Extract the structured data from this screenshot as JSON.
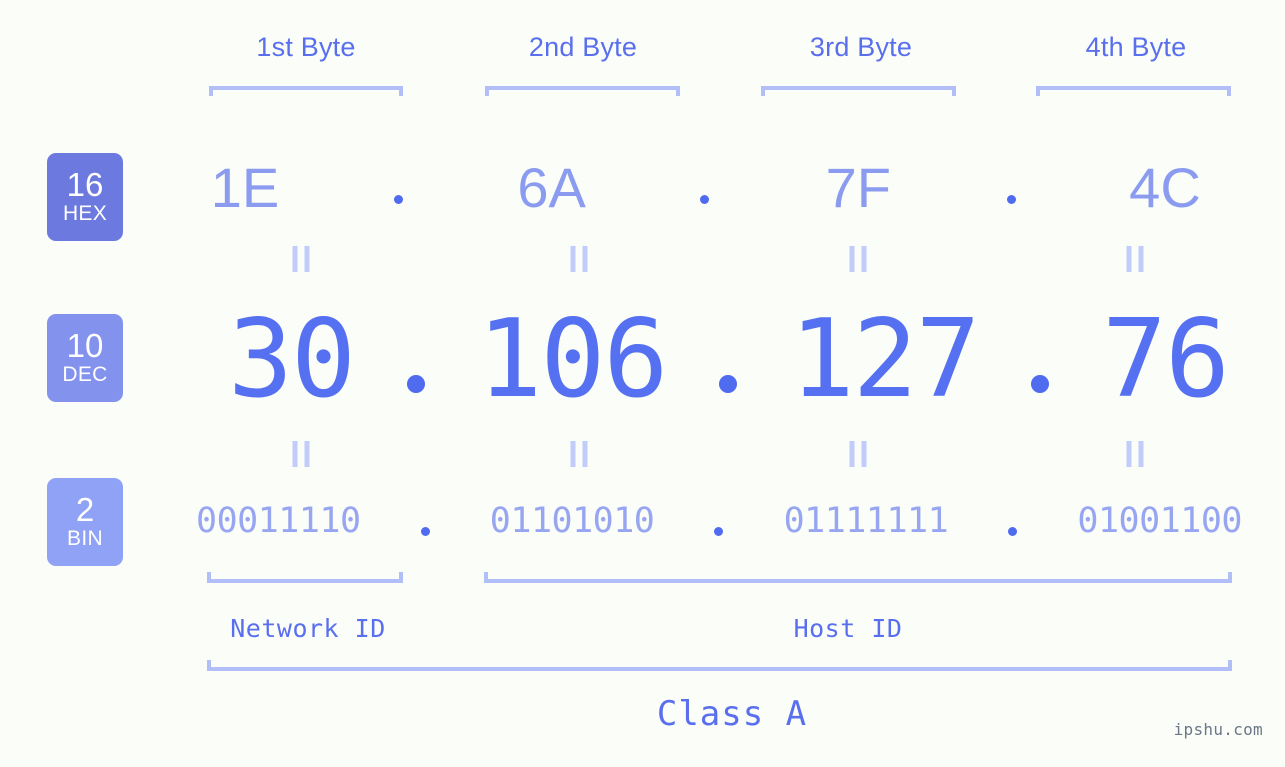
{
  "background_color": "#FAFDF8",
  "accent_colors": {
    "hex_text": "#8B9BF0",
    "dec_text": "#5570F1",
    "bin_text": "#98A6F1",
    "bracket": "#B2BEF8",
    "label": "#5A6FEE",
    "dot": "#4F6BEF",
    "badge_hex": "#6C7AE0",
    "badge_dec": "#8392EC",
    "badge_bin": "#8FA2F5"
  },
  "byte_headers": [
    {
      "label": "1st Byte"
    },
    {
      "label": "2nd Byte"
    },
    {
      "label": "3rd Byte"
    },
    {
      "label": "4th Byte"
    }
  ],
  "bases": [
    {
      "number": "16",
      "name": "HEX"
    },
    {
      "number": "10",
      "name": "DEC"
    },
    {
      "number": "2",
      "name": "BIN"
    }
  ],
  "rows": {
    "hex": {
      "octets": [
        "1E",
        "6A",
        "7F",
        "4C"
      ],
      "separator": "."
    },
    "dec": {
      "octets": [
        "30",
        "106",
        "127",
        "76"
      ],
      "separator": "."
    },
    "bin": {
      "octets": [
        "00011110",
        "01101010",
        "01111111",
        "01001100"
      ],
      "separator": "."
    }
  },
  "equals_symbol": "‖",
  "segments": {
    "network_id": "Network ID",
    "host_id": "Host ID",
    "class": "Class A"
  },
  "watermark": "ipshu.com"
}
